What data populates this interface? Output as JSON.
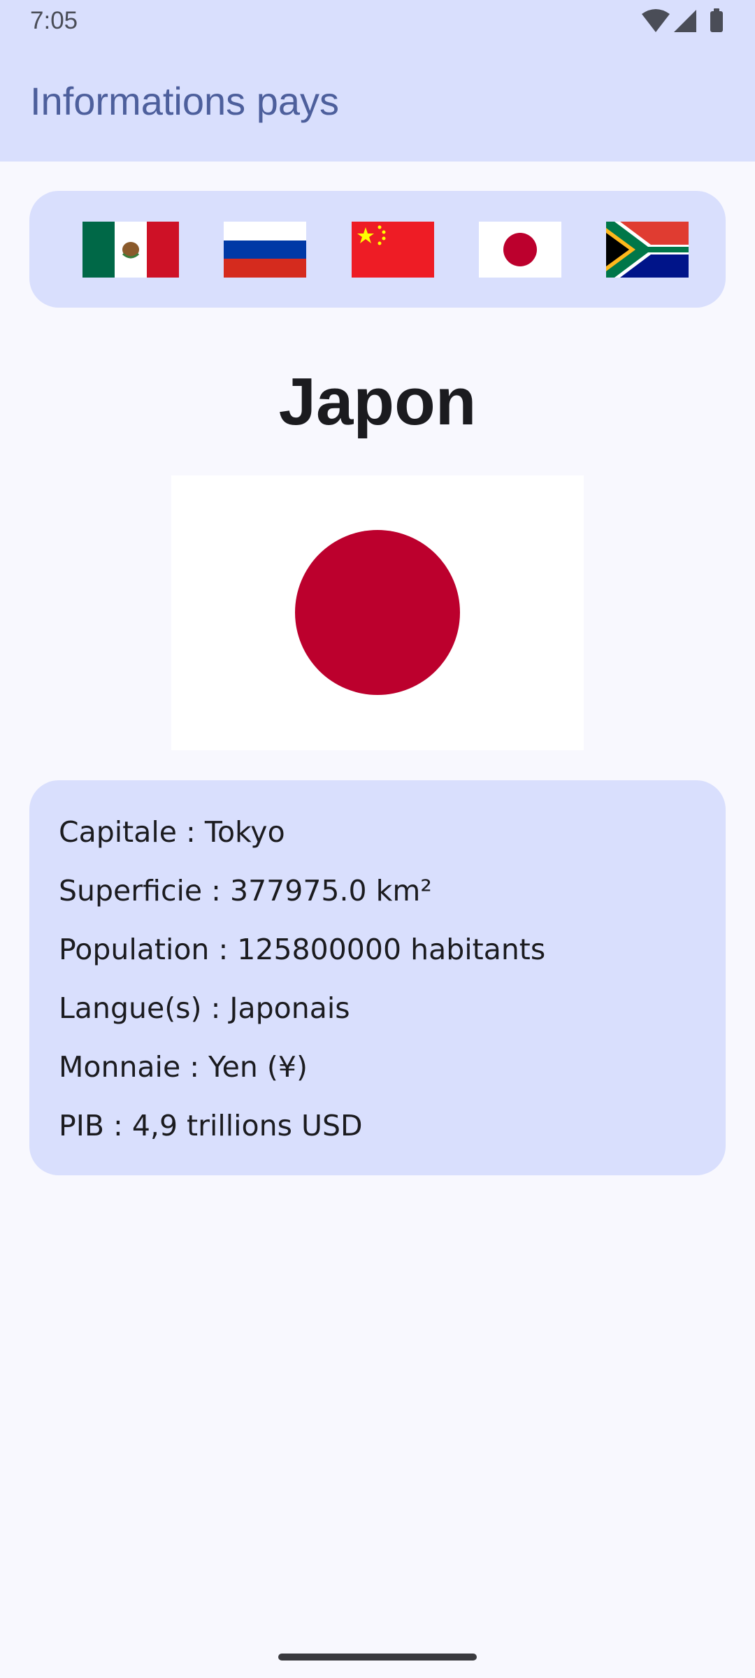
{
  "status_bar": {
    "time": "7:05",
    "icons": [
      "wifi-icon",
      "signal-icon",
      "battery-icon"
    ]
  },
  "app_bar": {
    "title": "Informations pays"
  },
  "flag_selector": {
    "items": [
      {
        "country": "mexico",
        "icon": "mexico-flag-icon"
      },
      {
        "country": "russia",
        "icon": "russia-flag-icon"
      },
      {
        "country": "china",
        "icon": "china-flag-icon"
      },
      {
        "country": "japan",
        "icon": "japan-flag-icon"
      },
      {
        "country": "south-africa",
        "icon": "south-africa-flag-icon"
      }
    ]
  },
  "country": {
    "name": "Japon",
    "flag_icon": "japan-flag-icon"
  },
  "info": {
    "capital": "Capitale : Tokyo",
    "area": "Superficie : 377975.0 km²",
    "population": "Population : 125800000 habitants",
    "languages": "Langue(s) : Japonais",
    "currency": "Monnaie : Yen (¥)",
    "gdp": "PIB : 4,9 trillions USD"
  },
  "colors": {
    "app_bar_bg": "#d9dffd",
    "title_color": "#4d5f9c",
    "page_bg": "#f8f8fe",
    "japan_red": "#bc002d"
  }
}
